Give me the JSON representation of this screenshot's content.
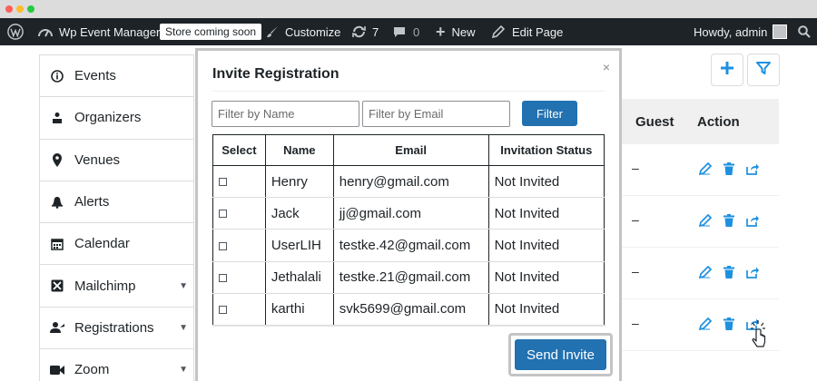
{
  "adminbar": {
    "site_name": "Wp Event Manager",
    "store_badge": "Store coming soon",
    "customize": "Customize",
    "updates_count": "7",
    "comments_count": "0",
    "new": "New",
    "edit_page": "Edit Page",
    "howdy": "Howdy, admin"
  },
  "sidebar": {
    "items": [
      {
        "label": "Events",
        "icon": "info-circle-icon"
      },
      {
        "label": "Organizers",
        "icon": "organizer-icon"
      },
      {
        "label": "Venues",
        "icon": "map-pin-icon"
      },
      {
        "label": "Alerts",
        "icon": "bell-icon"
      },
      {
        "label": "Calendar",
        "icon": "calendar-icon"
      },
      {
        "label": "Mailchimp",
        "icon": "mailchimp-icon"
      },
      {
        "label": "Registrations",
        "icon": "registrations-icon"
      },
      {
        "label": "Zoom",
        "icon": "video-camera-icon"
      }
    ]
  },
  "background_table": {
    "headers": {
      "guest": "Guest",
      "action": "Action"
    },
    "rows": [
      "–",
      "–",
      "–",
      "–"
    ]
  },
  "modal": {
    "title": "Invite Registration",
    "close": "×",
    "filter_name_placeholder": "Filter by Name",
    "filter_email_placeholder": "Filter by Email",
    "filter_button": "Filter",
    "columns": [
      "Select",
      "Name",
      "Email",
      "Invitation Status"
    ],
    "rows": [
      {
        "name": "Henry",
        "email": "henry@gmail.com",
        "status": "Not Invited"
      },
      {
        "name": "Jack",
        "email": "jj@gmail.com",
        "status": "Not Invited"
      },
      {
        "name": "UserLIH",
        "email": "testke.42@gmail.com",
        "status": "Not Invited"
      },
      {
        "name": "Jethalali",
        "email": "testke.21@gmail.com",
        "status": "Not Invited"
      },
      {
        "name": "karthi",
        "email": "svk5699@gmail.com",
        "status": "Not Invited"
      }
    ],
    "send_button": "Send Invite"
  },
  "colors": {
    "admin_bar": "#1d2327",
    "primary": "#2271b1",
    "action_icon": "#1e90e0"
  }
}
